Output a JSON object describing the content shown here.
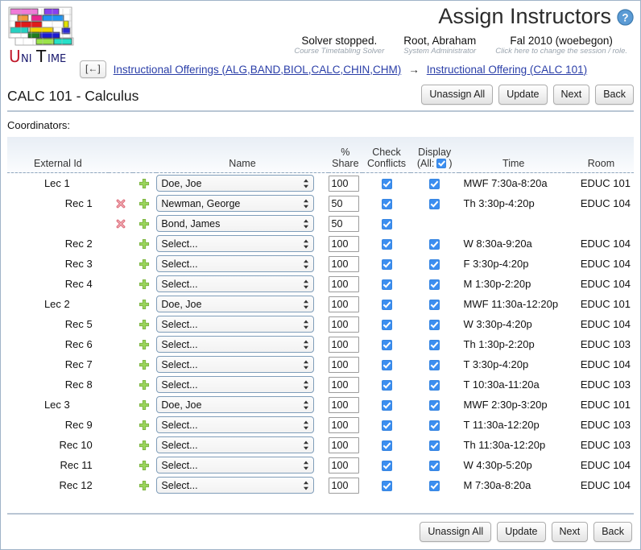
{
  "app": {
    "logo_text": "UniTime",
    "logo_colors": [
      "#f07ad8",
      "#8a3ff0",
      "#f29a3c",
      "#e8268e",
      "#2196f3",
      "#e01b1b",
      "#f2d500",
      "#2b2bd4",
      "#26d0c0",
      "#1e7d1e",
      "#1b1bd0",
      "#9be34a",
      "#26e0c8",
      "#e0e000"
    ]
  },
  "header": {
    "title": "Assign Instructors",
    "help_icon": "question-circle-icon",
    "infos": [
      {
        "main": "Solver stopped.",
        "sub": "Course Timetabling Solver"
      },
      {
        "main": "Root, Abraham",
        "sub": "System Administrator"
      },
      {
        "main": "Fal 2010 (woebegon)",
        "sub": "Click here to change the session / role."
      }
    ]
  },
  "breadcrumb": {
    "back_label": "[←]",
    "items": [
      "Instructional Offerings (ALG,BAND,BIOL,CALC,CHIN,CHM)",
      "Instructional Offering (CALC 101)"
    ],
    "separator": "→"
  },
  "page": {
    "title": "CALC 101 - Calculus",
    "coordinators_label": "Coordinators:"
  },
  "toolbar": {
    "unassign_all": "Unassign All",
    "update": "Update",
    "next": "Next",
    "back": "Back"
  },
  "table": {
    "headers": {
      "label": "",
      "delete": "",
      "add": "",
      "external_id": "External Id",
      "name": "Name",
      "share": "% Share",
      "check_top": "Check",
      "check_bottom": "Conflicts",
      "display_top": "Display",
      "display_all_prefix": "(All:",
      "display_all_suffix": ")",
      "time": "Time",
      "room": "Room"
    },
    "select_placeholder": "Select...",
    "rows": [
      {
        "label": "Lec 1",
        "level": "lec",
        "has_delete": false,
        "has_add": true,
        "name": "Doe, Joe",
        "share": "100",
        "check": true,
        "display": true,
        "time": "MWF 7:30a-8:20a",
        "room": "EDUC 101"
      },
      {
        "label": "Rec 1",
        "level": "rec",
        "has_delete": true,
        "has_add": true,
        "name": "Newman, George",
        "share": "50",
        "check": true,
        "display": true,
        "time": "Th 3:30p-4:20p",
        "room": "EDUC 104"
      },
      {
        "label": "",
        "level": "rec",
        "has_delete": true,
        "has_add": true,
        "name": "Bond, James",
        "share": "50",
        "check": true,
        "display": false,
        "time": "",
        "room": ""
      },
      {
        "label": "Rec 2",
        "level": "rec",
        "has_delete": false,
        "has_add": true,
        "name": "Select...",
        "share": "100",
        "check": true,
        "display": true,
        "time": "W 8:30a-9:20a",
        "room": "EDUC 104"
      },
      {
        "label": "Rec 3",
        "level": "rec",
        "has_delete": false,
        "has_add": true,
        "name": "Select...",
        "share": "100",
        "check": true,
        "display": true,
        "time": "F 3:30p-4:20p",
        "room": "EDUC 104"
      },
      {
        "label": "Rec 4",
        "level": "rec",
        "has_delete": false,
        "has_add": true,
        "name": "Select...",
        "share": "100",
        "check": true,
        "display": true,
        "time": "M 1:30p-2:20p",
        "room": "EDUC 104"
      },
      {
        "label": "Lec 2",
        "level": "lec",
        "has_delete": false,
        "has_add": true,
        "name": "Doe, Joe",
        "share": "100",
        "check": true,
        "display": true,
        "time": "MWF 11:30a-12:20p",
        "room": "EDUC 101"
      },
      {
        "label": "Rec 5",
        "level": "rec",
        "has_delete": false,
        "has_add": true,
        "name": "Select...",
        "share": "100",
        "check": true,
        "display": true,
        "time": "W 3:30p-4:20p",
        "room": "EDUC 104"
      },
      {
        "label": "Rec 6",
        "level": "rec",
        "has_delete": false,
        "has_add": true,
        "name": "Select...",
        "share": "100",
        "check": true,
        "display": true,
        "time": "Th 1:30p-2:20p",
        "room": "EDUC 103"
      },
      {
        "label": "Rec 7",
        "level": "rec",
        "has_delete": false,
        "has_add": true,
        "name": "Select...",
        "share": "100",
        "check": true,
        "display": true,
        "time": "T 3:30p-4:20p",
        "room": "EDUC 104"
      },
      {
        "label": "Rec 8",
        "level": "rec",
        "has_delete": false,
        "has_add": true,
        "name": "Select...",
        "share": "100",
        "check": true,
        "display": true,
        "time": "T 10:30a-11:20a",
        "room": "EDUC 103"
      },
      {
        "label": "Lec 3",
        "level": "lec",
        "has_delete": false,
        "has_add": true,
        "name": "Doe, Joe",
        "share": "100",
        "check": true,
        "display": true,
        "time": "MWF 2:30p-3:20p",
        "room": "EDUC 101"
      },
      {
        "label": "Rec 9",
        "level": "rec",
        "has_delete": false,
        "has_add": true,
        "name": "Select...",
        "share": "100",
        "check": true,
        "display": true,
        "time": "T 11:30a-12:20p",
        "room": "EDUC 103"
      },
      {
        "label": "Rec 10",
        "level": "rec",
        "has_delete": false,
        "has_add": true,
        "name": "Select...",
        "share": "100",
        "check": true,
        "display": true,
        "time": "Th 11:30a-12:20p",
        "room": "EDUC 103"
      },
      {
        "label": "Rec 11",
        "level": "rec",
        "has_delete": false,
        "has_add": true,
        "name": "Select...",
        "share": "100",
        "check": true,
        "display": true,
        "time": "W 4:30p-5:20p",
        "room": "EDUC 104"
      },
      {
        "label": "Rec 12",
        "level": "rec",
        "has_delete": false,
        "has_add": true,
        "name": "Select...",
        "share": "100",
        "check": true,
        "display": true,
        "time": "M 7:30a-8:20a",
        "room": "EDUC 104"
      }
    ]
  },
  "colors": {
    "link": "#2a3ea8",
    "checkbox": "#3b8ef0",
    "add_icon": "#8ccf52",
    "delete_icon": "#e0727f",
    "rule": "#b9c6d4"
  }
}
